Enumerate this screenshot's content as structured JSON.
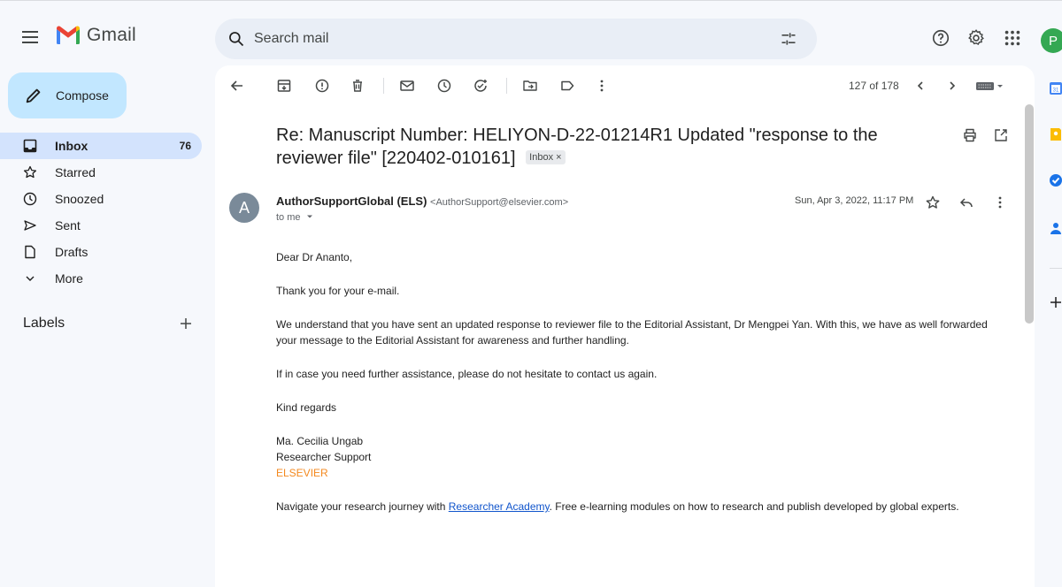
{
  "app": {
    "name": "Gmail"
  },
  "header": {
    "search_placeholder": "Search mail",
    "avatar_letter": "P"
  },
  "sidebar": {
    "compose_label": "Compose",
    "items": [
      {
        "label": "Inbox",
        "count": "76",
        "icon": "inbox-icon",
        "active": true
      },
      {
        "label": "Starred",
        "icon": "star-icon"
      },
      {
        "label": "Snoozed",
        "icon": "clock-icon"
      },
      {
        "label": "Sent",
        "icon": "send-icon"
      },
      {
        "label": "Drafts",
        "icon": "draft-icon"
      },
      {
        "label": "More",
        "icon": "chevron-down-icon"
      }
    ],
    "labels_title": "Labels"
  },
  "toolbar": {
    "pager": "127 of 178"
  },
  "email": {
    "subject": "Re: Manuscript Number: HELIYON-D-22-01214R1 Updated \"response to the reviewer file\" [220402-010161]",
    "label_chip": "Inbox ×",
    "sender_avatar": "A",
    "sender_name": "AuthorSupportGlobal (ELS)",
    "sender_email": "<AuthorSupport@elsevier.com>",
    "to": "to me",
    "date": "Sun, Apr 3, 2022, 11:17 PM",
    "body": {
      "greeting": "Dear Dr Ananto,",
      "p1": "Thank you for your e-mail.",
      "p2": "We understand that you have sent an updated response to reviewer file to the Editorial Assistant, Dr Mengpei Yan. With this, we have as well forwarded your message to the Editorial Assistant for awareness and further handling.",
      "p3": "If in case you need further assistance, please do not hesitate to contact us again.",
      "closing": "Kind regards",
      "sig_name": "Ma. Cecilia Ungab",
      "sig_title": "Researcher Support",
      "sig_company": "ELSEVIER",
      "footer_before": "Navigate your research journey with ",
      "footer_link": "Researcher Academy",
      "footer_after": ". Free e-learning modules on how to research and publish developed by global experts."
    }
  },
  "colors": {
    "accent": "#c2e7ff",
    "active_nav": "#d3e3fd",
    "elsevier_orange": "#f4891f",
    "link": "#1155cc"
  }
}
